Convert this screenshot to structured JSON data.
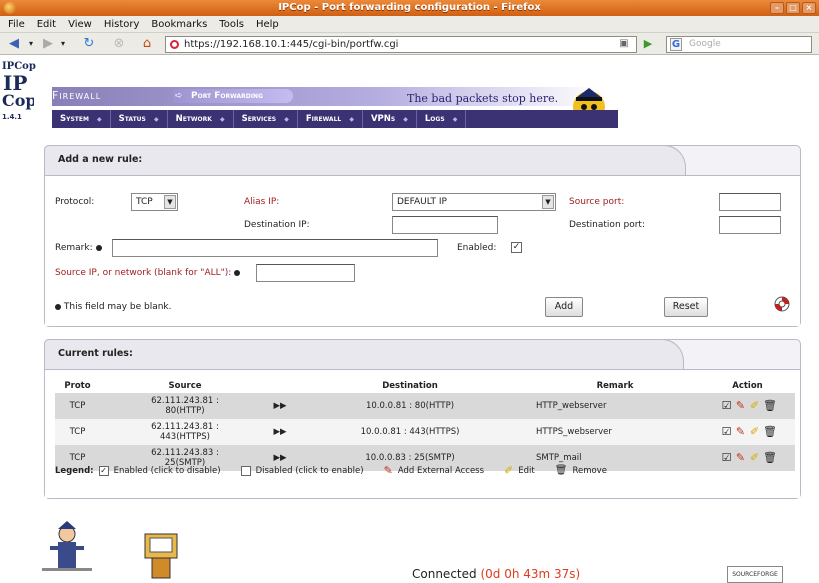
{
  "window": {
    "title": "IPCop - Port forwarding configuration - Firefox"
  },
  "menubar": [
    "File",
    "Edit",
    "View",
    "History",
    "Bookmarks",
    "Tools",
    "Help"
  ],
  "navigation": {
    "url": "https://192.168.10.1:445/cgi-bin/portfw.cgi",
    "search_placeholder": "Google"
  },
  "ipcop": {
    "logo": "IPCop",
    "version": "1.4.1",
    "section": "Firewall",
    "page": "Port Forwarding",
    "slogan": "The bad packets stop here.",
    "menu": [
      "System",
      "Status",
      "Network",
      "Services",
      "Firewall",
      "VPNs",
      "Logs"
    ]
  },
  "add_rule": {
    "title": "Add a new rule:",
    "protocol_label": "Protocol:",
    "protocol_value": "TCP",
    "alias_ip_label": "Alias IP:",
    "alias_ip_value": "DEFAULT IP",
    "source_port_label": "Source port:",
    "destination_ip_label": "Destination IP:",
    "destination_port_label": "Destination port:",
    "remark_label": "Remark:",
    "enabled_label": "Enabled:",
    "enabled_checked": "✓",
    "source_ip_label": "Source IP, or network (blank for \"ALL\"):",
    "note": "This field may be blank.",
    "add_button": "Add",
    "reset_button": "Reset"
  },
  "current_rules": {
    "title": "Current rules:",
    "columns": {
      "proto": "Proto",
      "source": "Source",
      "destination": "Destination",
      "remark": "Remark",
      "action": "Action"
    },
    "rows": [
      {
        "proto": "TCP",
        "source_ip": "62.111.243.81 :",
        "source_port": "80(HTTP)",
        "destination": "10.0.0.81 : 80(HTTP)",
        "remark": "HTTP_webserver"
      },
      {
        "proto": "TCP",
        "source_ip": "62.111.243.81 :",
        "source_port": "443(HTTPS)",
        "destination": "10.0.0.81 : 443(HTTPS)",
        "remark": "HTTPS_webserver"
      },
      {
        "proto": "TCP",
        "source_ip": "62.111.243.83 :",
        "source_port": "25(SMTP)",
        "destination": "10.0.0.83 : 25(SMTP)",
        "remark": "SMTP_mail"
      }
    ],
    "legend": {
      "label": "Legend:",
      "enabled": "Enabled (click to disable)",
      "disabled": "Disabled (click to enable)",
      "add_external": "Add External Access",
      "edit": "Edit",
      "remove": "Remove"
    }
  },
  "footer": {
    "connected_label": "Connected",
    "connected_time": "(0d 0h 43m 37s)",
    "sourceforge": "SOURCEFORGE"
  }
}
